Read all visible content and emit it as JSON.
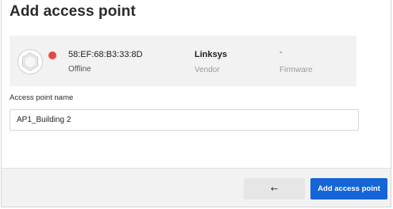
{
  "page": {
    "title": "Add access point"
  },
  "access_point": {
    "device_icon": "access-point-device-icon",
    "status_color": "#e8473f",
    "mac": "58:EF:68:B3:33:8D",
    "status": "Offline",
    "vendor": "Linksys",
    "vendor_label": "Vendor",
    "firmware": "-",
    "firmware_label": "Firmware"
  },
  "form": {
    "name_label": "Access point name",
    "name_value": "AP1_Building 2"
  },
  "footer": {
    "back_label": "←",
    "add_label": "Add access point",
    "accent_color": "#1565d8"
  }
}
